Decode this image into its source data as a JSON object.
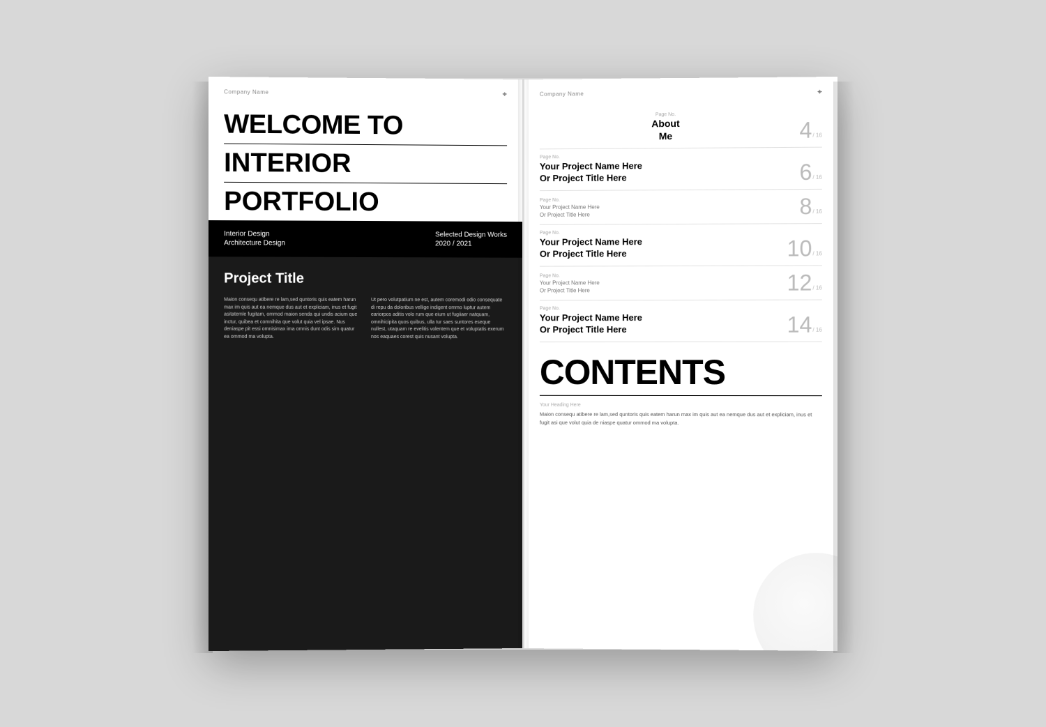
{
  "left_page": {
    "company_name": "Company Name",
    "logo_symbol": "⌖",
    "welcome_to": "WELCOME TO",
    "interior": "INTERIOR",
    "portfolio": "PORTFOLIO",
    "info_bar": {
      "col1_line1": "Interior Design",
      "col1_line2": "Architecture Design",
      "col2_line1": "Selected Design Works",
      "col2_line2": "2020 / 2021"
    },
    "project_title": "Project Title",
    "project_col1": "Maion consequ atibere re lam,sed quntoris quis eatem harun max im quis aut ea nemque dus aut et expliciam, inus et fugit asitatemle fugitam, ommod maion senda qui undis acium que inctur, quibea et comnihita que volut quia vel ipsae. Nus deniaspe pit essi omnisimax ima omnis dunt odis sim quatur ea ommod ma volupta.",
    "project_col2": "Ut pero volutpatium ne est, autem coremodi odio consequate di repu da doloribus vellige indigent ommo luptur autem eariorpos aditis volo rum que eium ut fugiiaer natquam, omnihicipita quos quibus, ulla tur saes suntores eseque nullest, utaquam re evelitis volentem que et voluptatis exerum nos eaquaes corest quis nusant volupta."
  },
  "right_page": {
    "company_name": "Company Name",
    "logo_symbol": "⌖",
    "toc": {
      "about": {
        "page_label": "Page No.",
        "title_line1": "About",
        "title_line2": "Me",
        "number": "4",
        "number_suffix": "/ 16"
      },
      "entries": [
        {
          "page_label": "Page No.",
          "title": "Your Project Name Here\nOr Project Title Here",
          "number": "6",
          "number_suffix": "/ 16"
        },
        {
          "page_label": "Page No.",
          "title_sm": "Your Project Name Here\nOr Project Title Here",
          "number": "8",
          "number_suffix": "/ 16"
        },
        {
          "page_label": "Page No.",
          "title": "Your Project Name Here\nOr Project Title Here",
          "number": "10",
          "number_suffix": "/ 16"
        },
        {
          "page_label": "Page No.",
          "title_sm": "Your Project Name Here\nOr Project Title Here",
          "number": "12",
          "number_suffix": "/ 16"
        },
        {
          "page_label": "Page No.",
          "title": "Your Project Name Here\nOr Project Title Here",
          "number": "14",
          "number_suffix": "/ 16"
        }
      ]
    },
    "contents_title": "CONTENTS",
    "your_heading": "Your Heading Here",
    "contents_desc": "Maion consequ atibere re lam,sed quntoris quis eatem harun max im quis aut ea nemque dus aut et expliciam, inus et fugit asi que volut quia de niaspe quatur ommod ma volupta."
  }
}
